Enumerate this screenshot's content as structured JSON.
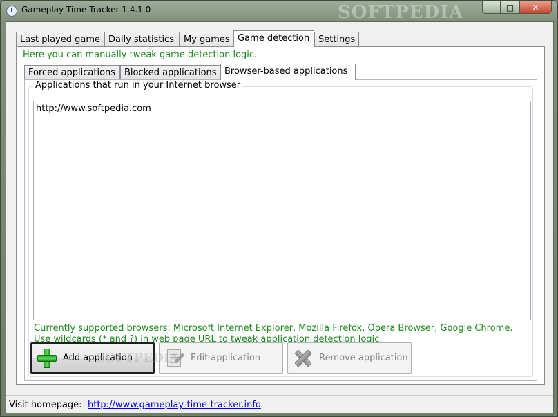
{
  "window": {
    "title": "Gameplay Time Tracker 1.4.1.0",
    "watermark": "SOFTPEDIA",
    "controls": {
      "minimize": "–",
      "maximize": "□",
      "close": "✕"
    }
  },
  "main_tabs": [
    {
      "label": "Last played game"
    },
    {
      "label": "Daily statistics"
    },
    {
      "label": "My games"
    },
    {
      "label": "Game detection",
      "active": true
    },
    {
      "label": "Settings"
    }
  ],
  "detection": {
    "intro": "Here you can manually tweak game detection logic.",
    "sub_tabs": [
      {
        "label": "Forced applications"
      },
      {
        "label": "Blocked applications"
      },
      {
        "label": "Browser-based applications",
        "active": true
      }
    ],
    "group_label": "Applications that run in your Internet browser",
    "applications": [
      "http://www.softpedia.com"
    ],
    "supported_browsers": "Currently supported browsers: Microsoft Internet Explorer, Mozilla Firefox, Opera Browser, Google Chrome.",
    "wildcards_hint": "Use wildcards (* and ?) in web page URL to tweak application detection logic.",
    "buttons": {
      "add": {
        "label": "Add application",
        "icon": "plus-icon",
        "enabled": true
      },
      "edit": {
        "label": "Edit application",
        "icon": "edit-document-icon",
        "enabled": false
      },
      "remove": {
        "label": "Remove application",
        "icon": "remove-x-icon",
        "enabled": false
      }
    },
    "button_watermark": "SOFTPEDIA"
  },
  "status": {
    "label": "Visit homepage:",
    "link": "http://www.gameplay-time-tracker.info"
  },
  "colors": {
    "info_text": "#1a8a1a",
    "link": "#0000ee"
  }
}
